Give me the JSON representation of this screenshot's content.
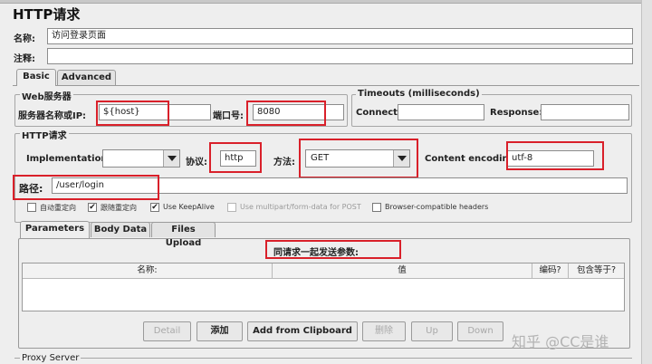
{
  "title": "HTTP请求",
  "name_label": "名称:",
  "name_value": "访问登录页面",
  "comment_label": "注释:",
  "comment_value": "",
  "tabs": [
    "Basic",
    "Advanced"
  ],
  "web_server": {
    "legend": "Web服务器",
    "server_label": "服务器名称或IP:",
    "server_value": "${host}",
    "port_label": "端口号:",
    "port_value": "8080"
  },
  "timeouts": {
    "legend": "Timeouts (milliseconds)",
    "connect_label": "Connect:",
    "connect_value": "",
    "response_label": "Response:",
    "response_value": ""
  },
  "http_request": {
    "legend": "HTTP请求",
    "implementation_label": "Implementation:",
    "implementation_value": "",
    "protocol_label": "协议:",
    "protocol_value": "http",
    "method_label": "方法:",
    "method_value": "GET",
    "encoding_label": "Content encoding:",
    "encoding_value": "utf-8",
    "path_label": "路径:",
    "path_value": "/user/login"
  },
  "checkboxes": [
    {
      "label": "自动重定向",
      "checked": false,
      "enabled": true
    },
    {
      "label": "跟随重定向",
      "checked": true,
      "enabled": true
    },
    {
      "label": "Use KeepAlive",
      "checked": true,
      "enabled": true
    },
    {
      "label": "Use multipart/form-data for POST",
      "checked": false,
      "enabled": false
    },
    {
      "label": "Browser-compatible headers",
      "checked": false,
      "enabled": true
    }
  ],
  "param_tabs": [
    "Parameters",
    "Body Data",
    "Files Upload"
  ],
  "params_caption": "同请求一起发送参数:",
  "table_headers": [
    "名称:",
    "值",
    "编码?",
    "包含等于?"
  ],
  "buttons": [
    {
      "label": "Detail",
      "enabled": false
    },
    {
      "label": "添加",
      "enabled": true
    },
    {
      "label": "Add from Clipboard",
      "enabled": true
    },
    {
      "label": "删除",
      "enabled": false
    },
    {
      "label": "Up",
      "enabled": false
    },
    {
      "label": "Down",
      "enabled": false
    }
  ],
  "proxy_label": "Proxy Server",
  "watermark": "知乎 @CC是谁",
  "colors": {
    "highlight": "#d9202a",
    "panel": "#eeeeee"
  }
}
